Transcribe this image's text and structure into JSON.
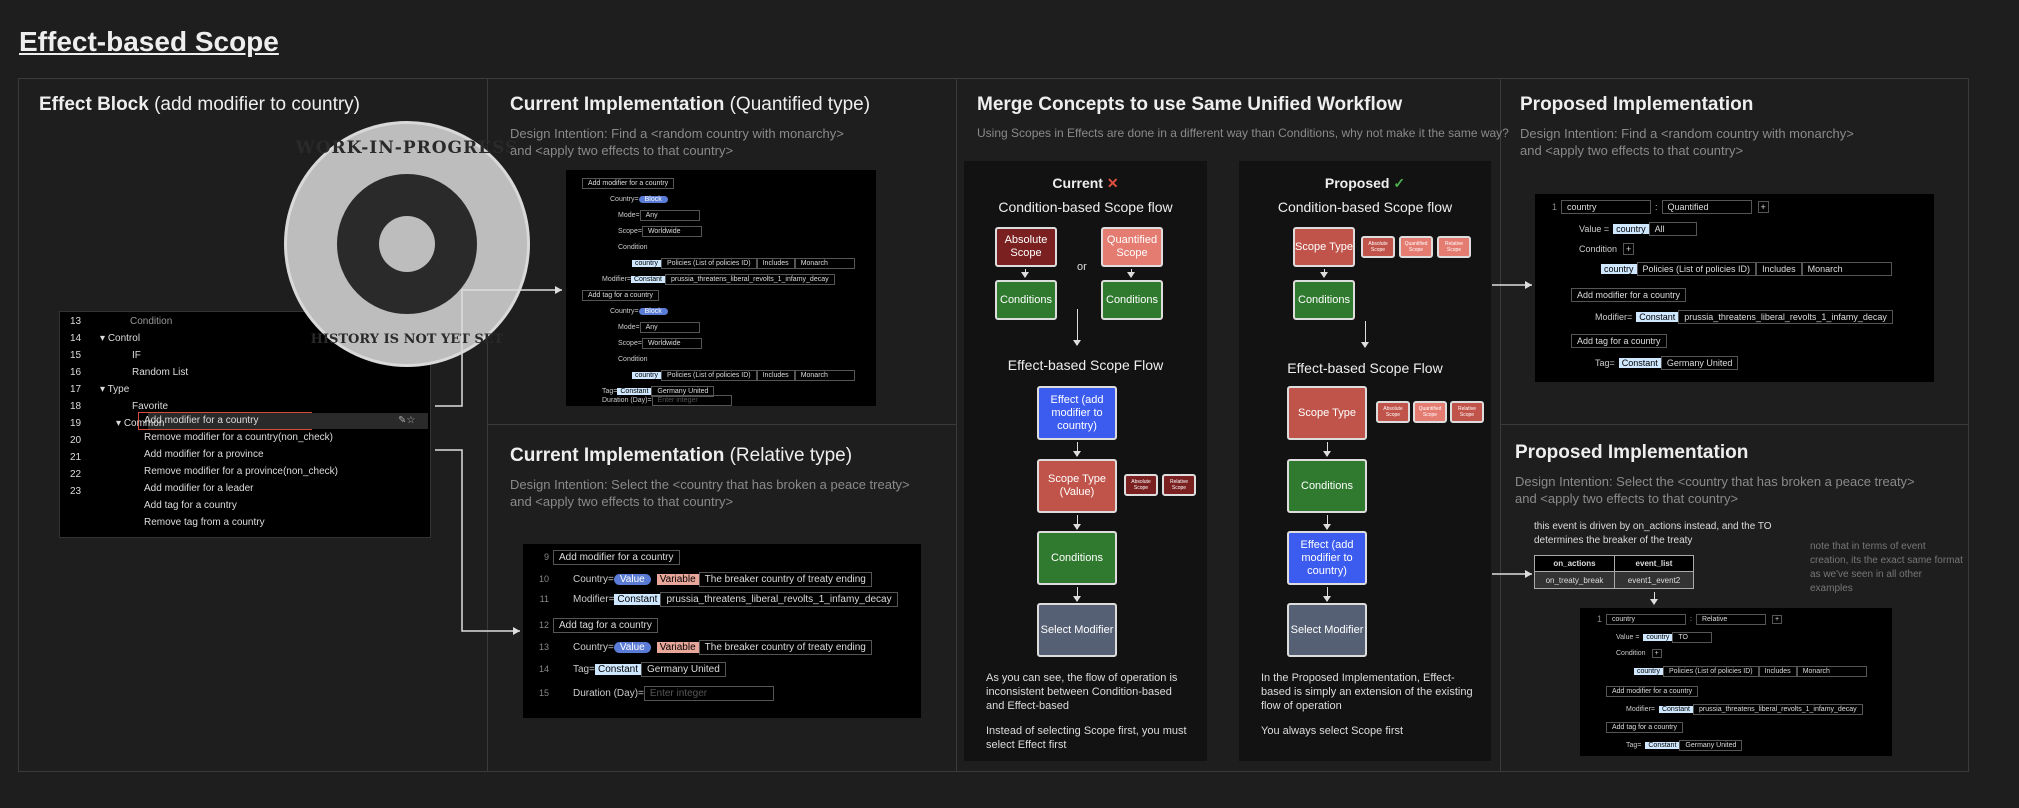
{
  "page": {
    "title": "Effect-based Scope"
  },
  "col1": {
    "title_bold": "Effect Block",
    "title_rest": " (add modifier to country)"
  },
  "stamp": {
    "top": "WORK-IN-PROGRESS",
    "bottom": "HISTORY IS NOT YET SET"
  },
  "menu": {
    "rows": [
      {
        "num": "13",
        "label": "Condition",
        "indent": 1
      },
      {
        "num": "14",
        "label": "Control",
        "indent": 0
      },
      {
        "num": "15",
        "label": "IF",
        "indent": 1
      },
      {
        "num": "16",
        "label": "Random List",
        "indent": 1
      },
      {
        "num": "17",
        "label": "Type",
        "indent": 0
      },
      {
        "num": "18",
        "label": "Favorite",
        "indent": 1
      },
      {
        "num": "19",
        "label": "Common",
        "indent": 1
      },
      {
        "num": "20",
        "label": "Add modifier for a country",
        "indent": 2
      },
      {
        "num": "21",
        "label": "Remove modifier for a country(non_check)",
        "indent": 2
      },
      {
        "num": "22",
        "label": "Add modifier for a province",
        "indent": 2
      },
      {
        "num": "23",
        "label": "Remove modifier for a province(non_check)",
        "indent": 2
      },
      {
        "num": "",
        "label": "Add modifier for a leader",
        "indent": 2
      },
      {
        "num": "",
        "label": "Add tag for a country",
        "indent": 2
      },
      {
        "num": "",
        "label": "Remove tag from a country",
        "indent": 2
      }
    ]
  },
  "col2a": {
    "title_bold": "Current Implementation",
    "title_rest": " (Quantified type)",
    "intent1": "Design Intention: Find a <random country with monarchy>",
    "intent2": "and <apply two effects to that country>",
    "code": {
      "add_modifier": "Add modifier for a country",
      "country": "Country=",
      "pill": "Block",
      "mode": "Mode=",
      "mode_val": "Any",
      "scope": "Scope=",
      "scope_val": "Worldwide",
      "condition": "Condition",
      "country_tag": "country",
      "policies": "Policies (List of policies ID)",
      "includes": "Includes",
      "monarch": "Monarch",
      "modifier": "Modifier=",
      "constant": "Constant",
      "modifier_val": "prussia_threatens_liberal_revolts_1_infamy_decay",
      "add_tag": "Add tag for a country",
      "tag": "Tag=",
      "tag_val": "Germany United",
      "duration": "Duration (Day)=",
      "duration_ph": "Enter integer"
    }
  },
  "col2b": {
    "title_bold": "Current Implementation",
    "title_rest": " (Relative type)",
    "intent1": "Design Intention: Select the <country that has broken a peace treaty>",
    "intent2": "and <apply two effects to that country>",
    "code": {
      "add_modifier": "Add modifier for a country",
      "country": "Country=",
      "value": "Value",
      "variable": "Variable",
      "breaker": "The breaker country of treaty ending",
      "modifier": "Modifier=",
      "constant": "Constant",
      "modifier_val": "prussia_threatens_liberal_revolts_1_infamy_decay",
      "add_tag": "Add tag for a country",
      "tag": "Tag=",
      "tag_val": "Germany United",
      "duration": "Duration (Day)=",
      "duration_ph": "Enter integer"
    }
  },
  "col3": {
    "title": "Merge Concepts to use Same Unified Workflow",
    "subtitle": "Using Scopes in Effects are done in a different way than Conditions, why not make it the same way?",
    "current": {
      "title": "Current",
      "cond_flow": "Condition-based Scope flow",
      "absolute": "Absolute Scope",
      "or": "or",
      "quantified": "Quantified Scope",
      "conditions": "Conditions",
      "effect_flow": "Effect-based Scope Flow",
      "effect": "Effect (add modifier to country)",
      "scope_type": "Scope Type (Value)",
      "mini1": "Absolute Scope",
      "mini2": "Relative Scope",
      "select_mod": "Select Modifier",
      "text1": "As you can see, the flow of operation is inconsistent between Condition-based and Effect-based",
      "text2": "Instead of selecting Scope first, you must select Effect first"
    },
    "proposed": {
      "title": "Proposed",
      "cond_flow": "Condition-based Scope flow",
      "scope_type": "Scope Type",
      "mini1": "Absolute Scope",
      "mini2": "Quantified Scope",
      "mini3": "Relative Scope",
      "conditions": "Conditions",
      "effect_flow": "Effect-based Scope Flow",
      "effect": "Effect (add modifier to country)",
      "select_mod": "Select Modifier",
      "text1": "In the Proposed Implementation, Effect-based is simply an extension of the existing flow of operation",
      "text2": "You always select Scope first"
    }
  },
  "col4a": {
    "title": "Proposed Implementation",
    "intent1": "Design Intention: Find a <random country with monarchy>",
    "intent2": "and <apply two effects to that country>",
    "code": {
      "num": "1",
      "country": "country",
      "quantified": "Quantified",
      "value": "Value =",
      "country_tag": "country",
      "all": "All",
      "condition": "Condition",
      "policies": "Policies (List of policies ID)",
      "includes": "Includes",
      "monarch": "Monarch",
      "add_modifier": "Add modifier for a country",
      "modifier": "Modifier=",
      "constant": "Constant",
      "modifier_val": "prussia_threatens_liberal_revolts_1_infamy_decay",
      "add_tag": "Add tag for a country",
      "tag": "Tag=",
      "tag_val": "Germany United"
    }
  },
  "col4b": {
    "title": "Proposed Implementation",
    "intent1": "Design Intention: Select the <country that has broken a peace treaty>",
    "intent2": "and <apply two effects to that country>",
    "note1": "this event is driven by on_actions instead, and the TO",
    "note2": "determines the breaker of the treaty",
    "table": {
      "h1": "on_actions",
      "h2": "event_list",
      "c1": "on_treaty_break",
      "c2": "event1_event2"
    },
    "side_note": "note that in terms of event creation, its the exact same format as we've seen in all other examples",
    "code": {
      "num": "1",
      "country": "country",
      "relative": "Relative",
      "value": "Value =",
      "country_tag": "country",
      "to": "TO",
      "condition": "Condition",
      "policies": "Policies (List of policies ID)",
      "includes": "Includes",
      "monarch": "Monarch",
      "add_modifier": "Add modifier for a country",
      "modifier": "Modifier=",
      "constant": "Constant",
      "modifier_val": "prussia_threatens_liberal_revolts_1_infamy_decay",
      "add_tag": "Add tag for a country",
      "tag": "Tag=",
      "tag_val": "Germany United"
    }
  }
}
